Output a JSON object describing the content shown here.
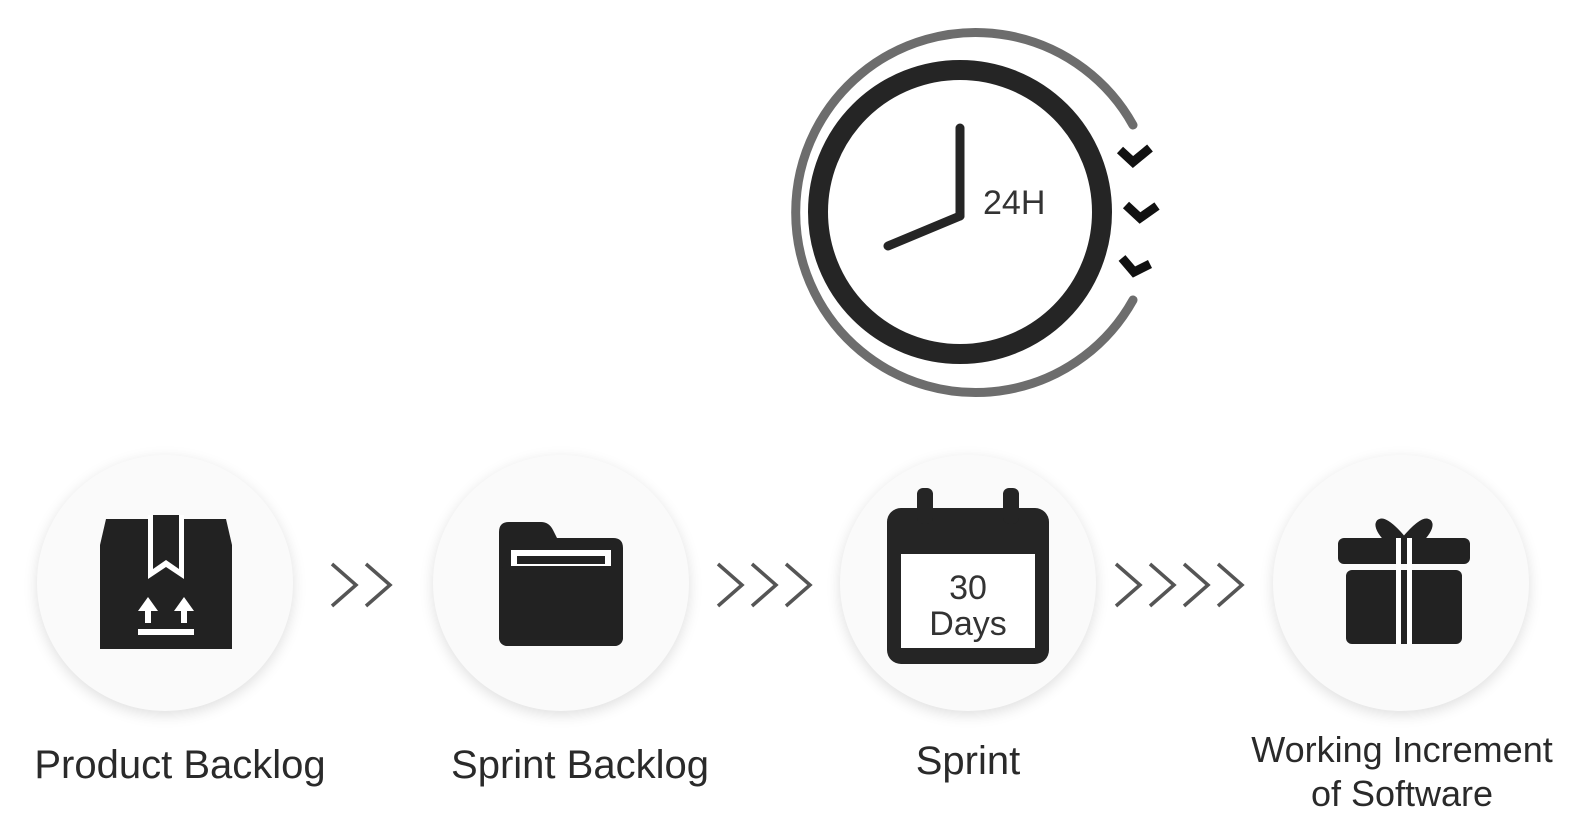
{
  "clock": {
    "label": "24H"
  },
  "steps": [
    {
      "label": "Product Backlog"
    },
    {
      "label": "Sprint Backlog"
    },
    {
      "label": "Sprint",
      "badge_line1": "30",
      "badge_line2": "Days"
    },
    {
      "label_line1": "Working Increment",
      "label_line2": "of Software"
    }
  ],
  "icons": [
    "box-icon",
    "folder-icon",
    "calendar-icon",
    "gift-icon",
    "clock-icon",
    "chevron-icon"
  ],
  "colors": {
    "icon": "#222222",
    "ring_gray": "#6d6d6d",
    "chevron_gray": "#555555"
  }
}
